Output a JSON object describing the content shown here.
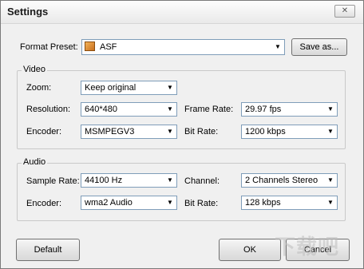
{
  "window": {
    "title": "Settings",
    "close_glyph": "✕"
  },
  "format_preset": {
    "label": "Format Preset:",
    "value": "ASF",
    "icon": "asf-format-icon",
    "save_label": "Save as..."
  },
  "video": {
    "group_label": "Video",
    "zoom_label": "Zoom:",
    "zoom_value": "Keep original",
    "resolution_label": "Resolution:",
    "resolution_value": "640*480",
    "frame_rate_label": "Frame Rate:",
    "frame_rate_value": "29.97 fps",
    "encoder_label": "Encoder:",
    "encoder_value": "MSMPEGV3",
    "bit_rate_label": "Bit Rate:",
    "bit_rate_value": "1200 kbps"
  },
  "audio": {
    "group_label": "Audio",
    "sample_rate_label": "Sample Rate:",
    "sample_rate_value": "44100 Hz",
    "channel_label": "Channel:",
    "channel_value": "2 Channels Stereo",
    "encoder_label": "Encoder:",
    "encoder_value": "wma2 Audio",
    "bit_rate_label": "Bit Rate:",
    "bit_rate_value": "128 kbps"
  },
  "buttons": {
    "default_label": "Default",
    "ok_label": "OK",
    "cancel_label": "Cancel"
  },
  "dropdown_arrow": "▼"
}
